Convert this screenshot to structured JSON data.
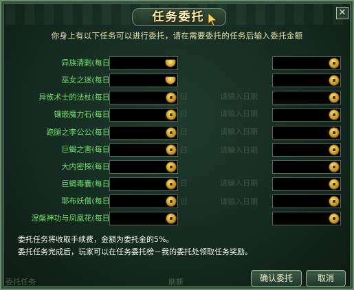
{
  "dialog": {
    "title": "任务委托",
    "close_label": "✕",
    "subtitle": "你身上有以下任务可以进行委托，请在需要委托的任务后输入委托金额",
    "tasks": [
      {
        "label": "异族清剿(每日)",
        "amount": "",
        "currency_icon": "gold-ingot-icon"
      },
      {
        "label": "巫女之迷(每日)",
        "amount": "",
        "currency_icon": "gold-ingot-icon"
      },
      {
        "label": "异族术士的法杖(每日)",
        "amount": "",
        "currency_icon": "coin-icon"
      },
      {
        "label": "镶嵌魔力石(每日)",
        "amount": "",
        "currency_icon": "coin-icon"
      },
      {
        "label": "跑腿之李公公(每日)",
        "amount": "",
        "currency_icon": "coin-icon"
      },
      {
        "label": "巨蝎之害(每日)",
        "amount": "",
        "currency_icon": "coin-icon"
      },
      {
        "label": "大内密探(每日)",
        "amount": "",
        "currency_icon": "coin-icon"
      },
      {
        "label": "巨蝎毒囊(每日)",
        "amount": "",
        "currency_icon": "coin-icon"
      },
      {
        "label": "耶布妖僧(每日)",
        "amount": "",
        "currency_icon": "coin-icon"
      },
      {
        "label": "涅槃神功与凤凰花(每日)",
        "amount": "",
        "currency_icon": "coin-icon"
      }
    ],
    "info_line1": "委托任务将收取手续费，金额为委托金的5%。",
    "info_line2": "委托任务完成后，玩家可以在任务委托榜－我的委托处领取任务奖励。",
    "confirm_label": "确认委托",
    "cancel_label": "取消"
  },
  "background": {
    "ghost_daily": "日",
    "ghost_note": "请输入日期",
    "bottom_left": "委托任务",
    "bottom_refresh": "刷新"
  }
}
